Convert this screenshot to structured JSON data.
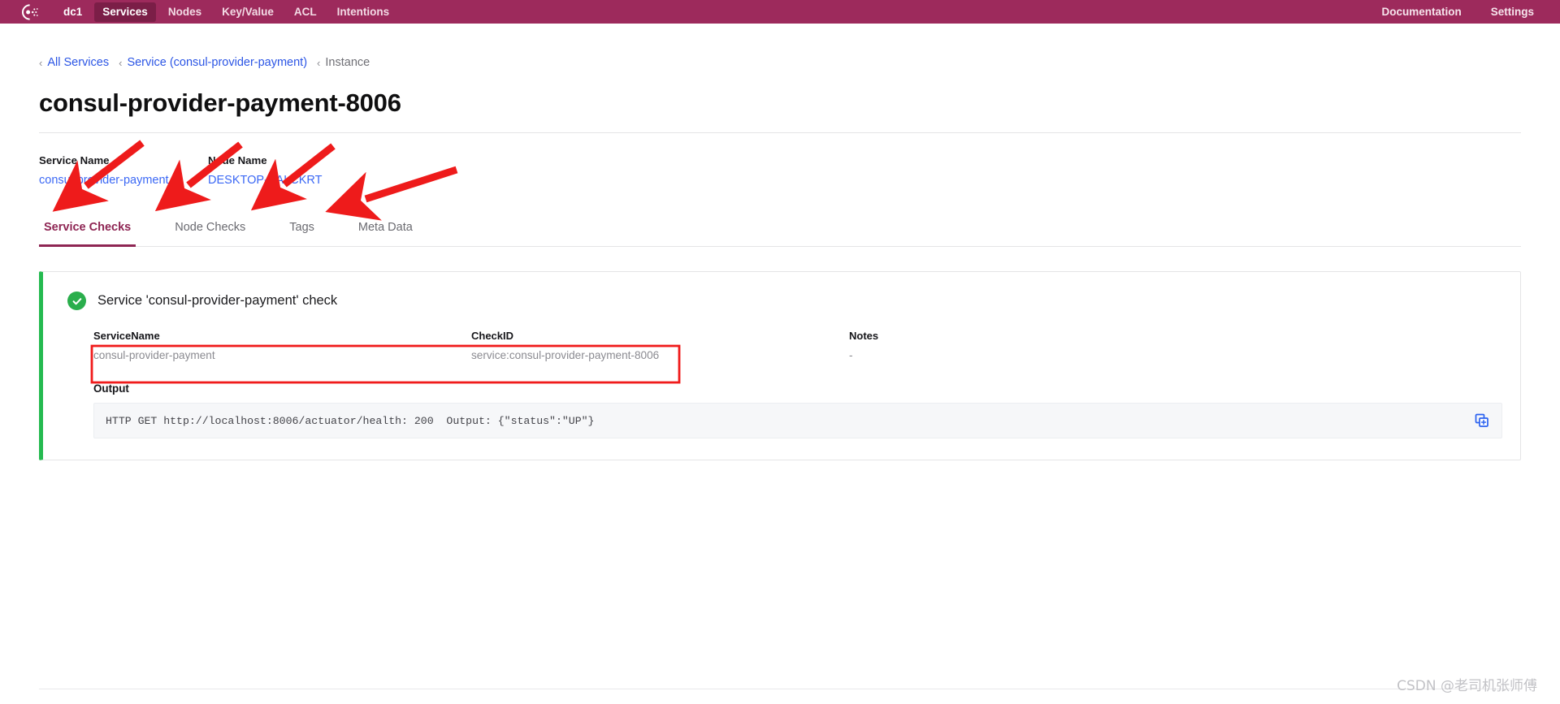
{
  "navbar": {
    "logo_icon": "consul-logo-icon",
    "brand_color": "#9d2a5c",
    "active_color": "#7b1e47",
    "datacenter": "dc1",
    "items": [
      {
        "label": "Services",
        "active": true
      },
      {
        "label": "Nodes",
        "active": false
      },
      {
        "label": "Key/Value",
        "active": false
      },
      {
        "label": "ACL",
        "active": false
      },
      {
        "label": "Intentions",
        "active": false
      }
    ],
    "right_items": [
      {
        "label": "Documentation"
      },
      {
        "label": "Settings"
      }
    ]
  },
  "breadcrumb": {
    "chevron_icon": "chevron-left-icon",
    "items": [
      {
        "label": "All Services",
        "link": true
      },
      {
        "label": "Service (consul-provider-payment)",
        "link": true
      },
      {
        "label": "Instance",
        "link": false
      }
    ]
  },
  "page": {
    "title": "consul-provider-payment-8006"
  },
  "meta": {
    "service": {
      "label": "Service Name",
      "value": "consul-provider-payment"
    },
    "node": {
      "label": "Node Name",
      "value": "DESKTOP-SALCKRT"
    },
    "link_color": "#3b68f5"
  },
  "tabs": {
    "active_color": "#8e2553",
    "items": [
      {
        "label": "Service Checks",
        "active": true
      },
      {
        "label": "Node Checks",
        "active": false
      },
      {
        "label": "Tags",
        "active": false
      },
      {
        "label": "Meta Data",
        "active": false
      }
    ]
  },
  "check_card": {
    "status": "passing",
    "status_color": "#25ba50",
    "status_icon": "check-circle-icon",
    "title": "Service 'consul-provider-payment' check",
    "fields": [
      {
        "label": "ServiceName",
        "value": "consul-provider-payment"
      },
      {
        "label": "CheckID",
        "value": "service:consul-provider-payment-8006"
      },
      {
        "label": "Notes",
        "value": "-"
      }
    ],
    "output": {
      "label": "Output",
      "value": "HTTP GET http://localhost:8006/actuator/health: 200  Output: {\"status\":\"UP\"}",
      "copy_icon": "copy-icon",
      "copy_icon_color": "#2b62f0"
    }
  },
  "annotations": {
    "arrow_color": "#ee1b1b",
    "highlight_color": "#f01b1b",
    "arrows": [
      {
        "name": "arrow-to-service-checks-tab",
        "target": "Service Checks"
      },
      {
        "name": "arrow-to-node-checks-tab",
        "target": "Node Checks"
      },
      {
        "name": "arrow-to-tags-tab",
        "target": "Tags"
      },
      {
        "name": "arrow-to-meta-data-tab",
        "target": "Meta Data"
      }
    ]
  },
  "watermark": {
    "text": "CSDN @老司机张师傅"
  }
}
